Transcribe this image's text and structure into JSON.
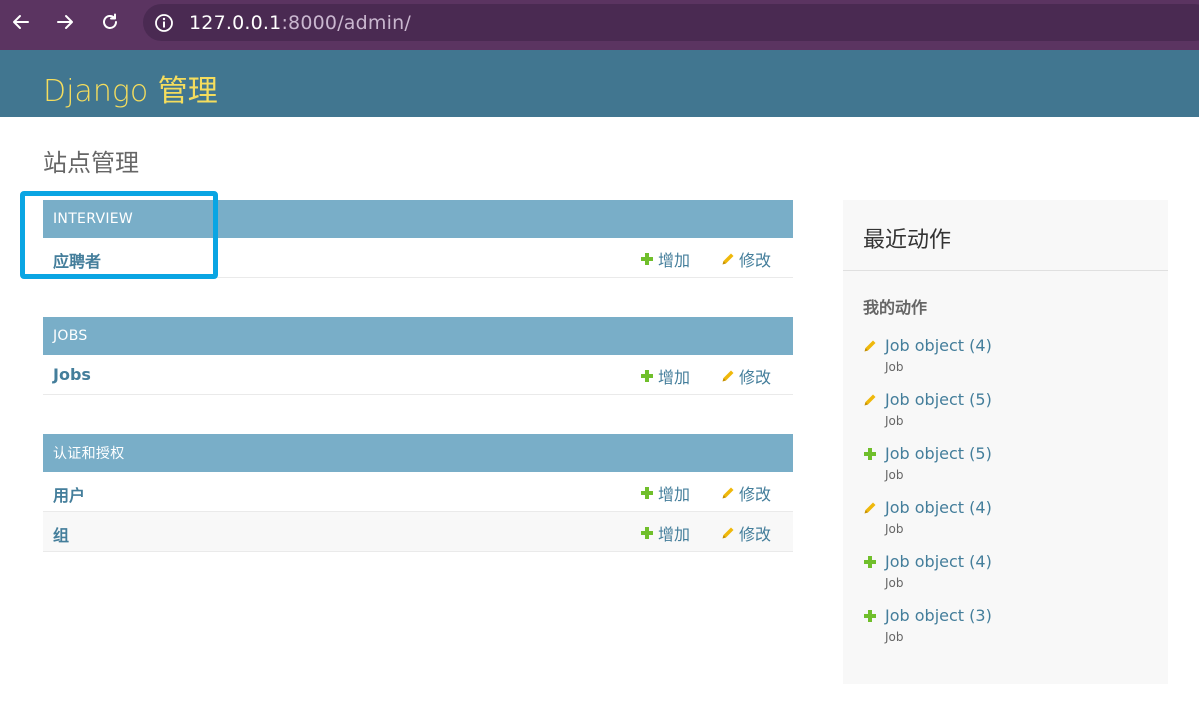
{
  "browser": {
    "url_host": "127.0.0.1",
    "url_rest": ":8000/admin/"
  },
  "header": {
    "branding": "Django 管理"
  },
  "page_title": "站点管理",
  "modules": [
    {
      "caption": "INTERVIEW",
      "models": [
        {
          "name": "应聘者",
          "add": "增加",
          "change": "修改"
        }
      ]
    },
    {
      "caption": "JOBS",
      "models": [
        {
          "name": "Jobs",
          "add": "增加",
          "change": "修改"
        }
      ]
    },
    {
      "caption": "认证和授权",
      "models": [
        {
          "name": "用户",
          "add": "增加",
          "change": "修改"
        },
        {
          "name": "组",
          "add": "增加",
          "change": "修改"
        }
      ]
    }
  ],
  "recent_actions": {
    "title": "最近动作",
    "subtitle": "我的动作",
    "items": [
      {
        "icon": "pencil-icon",
        "title": "Job object (4)",
        "type": "Job"
      },
      {
        "icon": "pencil-icon",
        "title": "Job object (5)",
        "type": "Job"
      },
      {
        "icon": "plus-icon",
        "title": "Job object (5)",
        "type": "Job"
      },
      {
        "icon": "pencil-icon",
        "title": "Job object (4)",
        "type": "Job"
      },
      {
        "icon": "plus-icon",
        "title": "Job object (4)",
        "type": "Job"
      },
      {
        "icon": "plus-icon",
        "title": "Job object (3)",
        "type": "Job"
      }
    ]
  },
  "colors": {
    "header_bg": "#417690",
    "branding": "#f5dd5d",
    "caption_bg": "#79aec8",
    "link": "#447e9b",
    "add_green": "#70bf2b",
    "change_yellow": "#efb80b",
    "highlight": "#0aa5e3"
  }
}
